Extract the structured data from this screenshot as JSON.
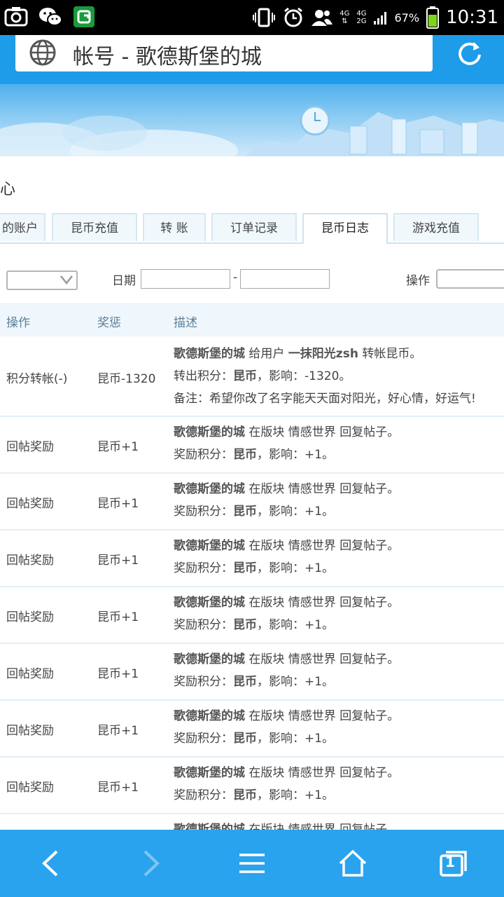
{
  "status_bar": {
    "network_top": "4G",
    "network_bottom_a": "4G",
    "network_bottom_b": "2G",
    "battery": "67%",
    "time": "10:31"
  },
  "browser": {
    "title": "帐号 - 歌德斯堡的城"
  },
  "page": {
    "heading": "心"
  },
  "tabs": [
    {
      "label": "的账户"
    },
    {
      "label": "昆币充值"
    },
    {
      "label": "转 账"
    },
    {
      "label": "订单记录"
    },
    {
      "label": "昆币日志",
      "active": true
    },
    {
      "label": "游戏充值"
    }
  ],
  "filters": {
    "date_label": "日期",
    "date_sep": "-",
    "action_label": "操作"
  },
  "table": {
    "headers": [
      "操作",
      "奖惩",
      "描述"
    ],
    "rows": [
      {
        "action": "积分转帐(-)",
        "reward": "昆币-1320",
        "line1_user": "歌德斯堡的城",
        "line1_mid": " 给用户 ",
        "line1_target": "一抹阳光zsh",
        "line1_tail": " 转帐昆币。",
        "line2_pre": "转出积分：",
        "line2_coin": "昆币",
        "line2_tail": "，影响：-1320。",
        "line3": "备注：希望你改了名字能天天面对阳光，好心情，好运气!"
      },
      {
        "action": "回帖奖励",
        "reward": "昆币+1",
        "line1_user": "歌德斯堡的城",
        "line1_tail": " 在版块 情感世界 回复帖子。",
        "line2_pre": "奖励积分：",
        "line2_coin": "昆币",
        "line2_tail": "，影响：+1。"
      },
      {
        "action": "回帖奖励",
        "reward": "昆币+1",
        "line1_user": "歌德斯堡的城",
        "line1_tail": " 在版块 情感世界 回复帖子。",
        "line2_pre": "奖励积分：",
        "line2_coin": "昆币",
        "line2_tail": "，影响：+1。"
      },
      {
        "action": "回帖奖励",
        "reward": "昆币+1",
        "line1_user": "歌德斯堡的城",
        "line1_tail": " 在版块 情感世界 回复帖子。",
        "line2_pre": "奖励积分：",
        "line2_coin": "昆币",
        "line2_tail": "，影响：+1。"
      },
      {
        "action": "回帖奖励",
        "reward": "昆币+1",
        "line1_user": "歌德斯堡的城",
        "line1_tail": " 在版块 情感世界 回复帖子。",
        "line2_pre": "奖励积分：",
        "line2_coin": "昆币",
        "line2_tail": "，影响：+1。"
      },
      {
        "action": "回帖奖励",
        "reward": "昆币+1",
        "line1_user": "歌德斯堡的城",
        "line1_tail": " 在版块 情感世界 回复帖子。",
        "line2_pre": "奖励积分：",
        "line2_coin": "昆币",
        "line2_tail": "，影响：+1。"
      },
      {
        "action": "回帖奖励",
        "reward": "昆币+1",
        "line1_user": "歌德斯堡的城",
        "line1_tail": " 在版块 情感世界 回复帖子。",
        "line2_pre": "奖励积分：",
        "line2_coin": "昆币",
        "line2_tail": "，影响：+1。"
      },
      {
        "action": "回帖奖励",
        "reward": "昆币+1",
        "line1_user": "歌德斯堡的城",
        "line1_tail": " 在版块 情感世界 回复帖子。",
        "line2_pre": "奖励积分：",
        "line2_coin": "昆币",
        "line2_tail": "，影响：+1。"
      },
      {
        "line1_user": "歌德斯堡的城",
        "line1_tail": " 在版块 情感世界 回复帖子。"
      }
    ]
  },
  "bottom_nav": {
    "tab_count": "1"
  },
  "icons": {
    "back": "back-arrow-icon",
    "forward": "forward-arrow-icon",
    "menu": "menu-icon",
    "home": "home-icon",
    "tabs": "tabs-icon",
    "refresh": "refresh-icon",
    "globe": "globe-icon"
  },
  "colors": {
    "accent": "#1e9be9",
    "nav": "#29a3ee"
  }
}
